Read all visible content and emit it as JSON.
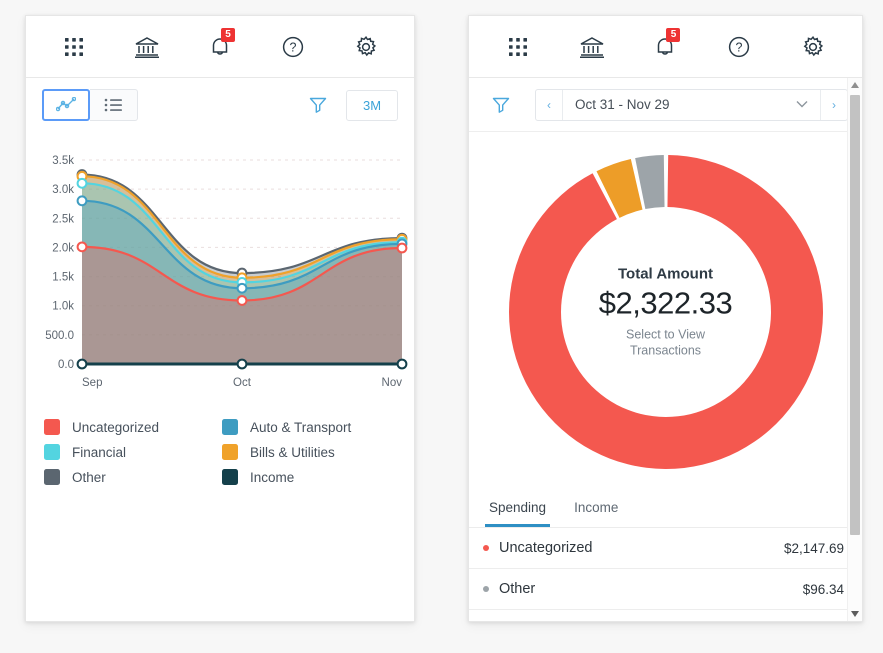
{
  "header": {
    "icons": [
      {
        "name": "apps-grid-icon",
        "label": "Apps"
      },
      {
        "name": "bank-icon",
        "label": "Accounts"
      },
      {
        "name": "bell-icon",
        "label": "Notifications",
        "badge": "5"
      },
      {
        "name": "help-icon",
        "label": "Help"
      },
      {
        "name": "gear-icon",
        "label": "Settings"
      }
    ]
  },
  "left_panel": {
    "toolbar": {
      "chart_view_label": "Chart view",
      "list_view_label": "List view",
      "filter_label": "Filter",
      "range_label": "3M"
    },
    "legend": [
      {
        "label": "Uncategorized",
        "color": "#F4584F"
      },
      {
        "label": "Auto & Transport",
        "color": "#3E9CC1"
      },
      {
        "label": "Financial",
        "color": "#53D4E0"
      },
      {
        "label": "Bills & Utilities",
        "color": "#F0A22A"
      },
      {
        "label": "Other",
        "color": "#5B6670"
      },
      {
        "label": "Income",
        "color": "#14404B"
      }
    ]
  },
  "chart_data": {
    "type": "area",
    "title": "",
    "xlabel": "",
    "ylabel": "",
    "categories": [
      "Sep",
      "Oct",
      "Nov"
    ],
    "ylim": [
      0,
      3500
    ],
    "ytick_labels": [
      "0.0",
      "500.0",
      "1.0k",
      "1.5k",
      "2.0k",
      "2.5k",
      "3.0k",
      "3.5k"
    ],
    "ytick_values": [
      0,
      500,
      1000,
      1500,
      2000,
      2500,
      3000,
      3500
    ],
    "grid": true,
    "legend_position": "below",
    "series": [
      {
        "name": "Other",
        "color": "#5B6670",
        "values": [
          3250,
          1560,
          2160
        ]
      },
      {
        "name": "Bills & Utilities",
        "color": "#F0A22A",
        "values": [
          3220,
          1480,
          2140
        ]
      },
      {
        "name": "Financial",
        "color": "#53D4E0",
        "values": [
          3100,
          1400,
          2090
        ]
      },
      {
        "name": "Auto & Transport",
        "color": "#3E9CC1",
        "values": [
          2800,
          1300,
          2060
        ]
      },
      {
        "name": "Uncategorized",
        "color": "#F4584F",
        "values": [
          2010,
          1090,
          1990
        ]
      },
      {
        "name": "Income",
        "color": "#14404B",
        "values": [
          0,
          0,
          0
        ]
      }
    ]
  },
  "right_panel": {
    "date_bar": {
      "filter_label": "Filter",
      "prev_label": "‹",
      "next_label": "›",
      "range_text": "Oct 31 - Nov 29",
      "chevron": "⌄"
    },
    "donut": {
      "title": "Total Amount",
      "amount": "$2,322.33",
      "subtitle_line1": "Select to View",
      "subtitle_line2": "Transactions"
    },
    "donut_data": {
      "type": "pie",
      "title": "Total Amount",
      "total": 2322.33,
      "slices": [
        {
          "label": "Uncategorized",
          "value": 2147.69,
          "color": "#F4584F"
        },
        {
          "label": "Bills & Utilities",
          "value": 96.34,
          "color": "#ED9D28"
        },
        {
          "label": "Other",
          "value": 78.3,
          "color": "#9DA4A9"
        }
      ]
    },
    "tabs": [
      {
        "label": "Spending",
        "active": true
      },
      {
        "label": "Income",
        "active": false
      }
    ],
    "categories": [
      {
        "name": "Uncategorized",
        "amount": "$2,147.69",
        "color": "#F4584F"
      },
      {
        "name": "Other",
        "amount": "$96.34",
        "color": "#9DA4A9"
      }
    ],
    "scrollbar": {
      "up": "▲",
      "down": "▼"
    }
  }
}
